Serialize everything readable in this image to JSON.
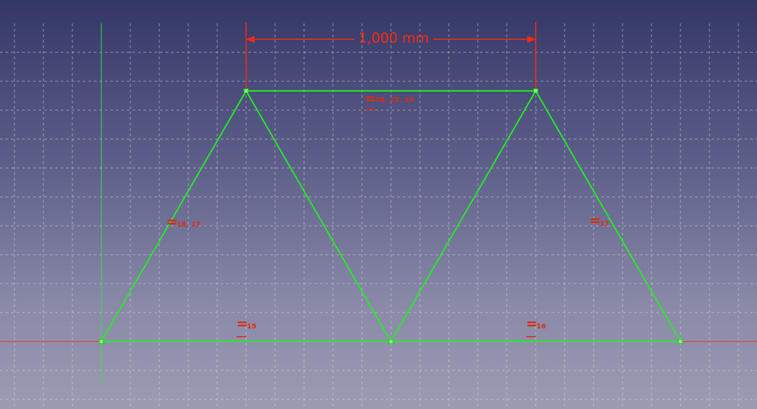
{
  "app": {
    "view": "sketch-canvas"
  },
  "colors": {
    "edge": "#22ee22",
    "constraint": "#e02a10",
    "dimension": "#ff2a10",
    "x_axis": "#ff2a1a",
    "y_axis": "#39e04a",
    "background_top": "#343766",
    "background_bottom": "#9c9bb2"
  },
  "dimension": {
    "text": "1,000 mm"
  },
  "constraints": [
    {
      "id": "top",
      "symbol": "=",
      "indices": "18, 15, 16"
    },
    {
      "id": "left",
      "symbol": "=",
      "indices": "18, 17"
    },
    {
      "id": "right",
      "symbol": "=",
      "indices": "17"
    },
    {
      "id": "bottom-left",
      "symbol": "=",
      "indices": "15"
    },
    {
      "id": "bottom-right",
      "symbol": "=",
      "indices": "16"
    }
  ],
  "icons": {
    "equality": "equal-constraint-icon"
  }
}
